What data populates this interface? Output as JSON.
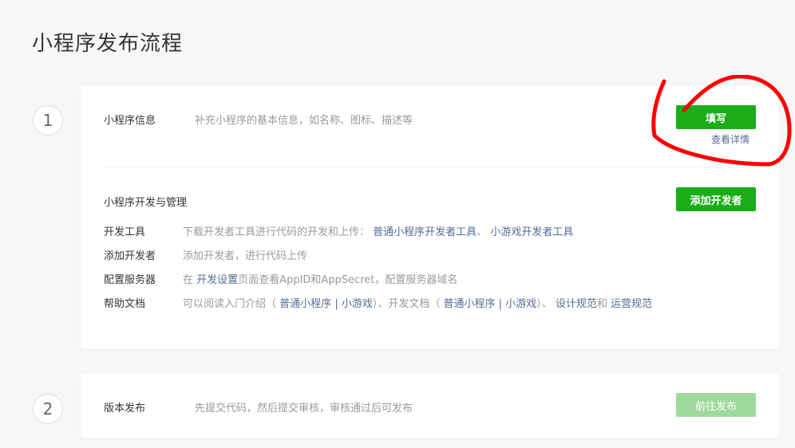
{
  "page": {
    "title": "小程序发布流程"
  },
  "step1": {
    "number": "1",
    "info": {
      "label": "小程序信息",
      "desc": "补充小程序的基本信息，如名称、图标、描述等",
      "button": "填写",
      "detail": "查看详情"
    },
    "dev": {
      "title": "小程序开发与管理",
      "button": "添加开发者",
      "rows": [
        {
          "key": "开发工具",
          "text": "下载开发者工具进行代码的开发和上传：",
          "link1": "普通小程序开发者工具",
          "sep": "、",
          "link2": "小游戏开发者工具"
        },
        {
          "key": "添加开发者",
          "text": "添加开发者，进行代码上传"
        },
        {
          "key": "配置服务器",
          "pre": "在",
          "link": "开发设置",
          "post": "页面查看AppID和AppSecret，配置服务器域名"
        },
        {
          "key": "帮助文档",
          "t1": "可以阅读入门介绍（",
          "l1": "普通小程序",
          "bar1": "|",
          "l2": "小游戏",
          "t2": "）、开发文档（",
          "l3": "普通小程序",
          "bar2": "|",
          "l4": "小游戏",
          "t3": "）、",
          "l5": "设计规范",
          "t4": "和",
          "l6": "运营规范"
        }
      ]
    }
  },
  "step2": {
    "number": "2",
    "label": "版本发布",
    "desc": "先提交代码，然后提交审核，审核通过后可发布",
    "button": "前往发布"
  }
}
